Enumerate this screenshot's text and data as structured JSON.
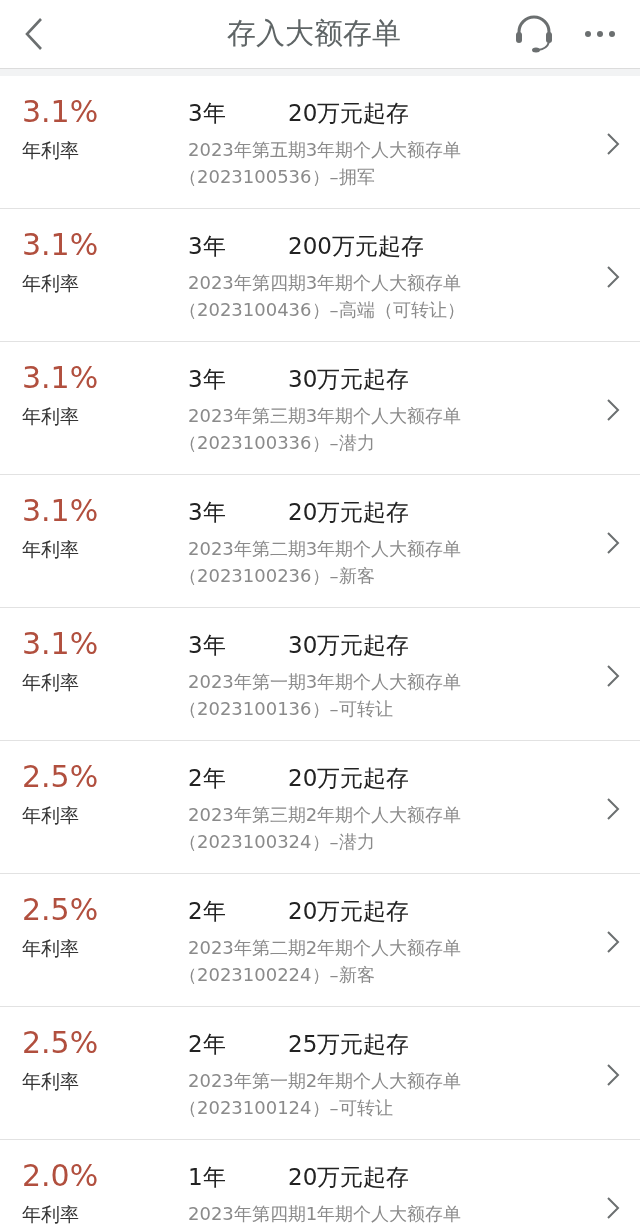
{
  "header": {
    "title": "存入大额存单"
  },
  "products": [
    {
      "rate": "3.1%",
      "rate_label": "年利率",
      "term": "3年",
      "minimum": "20万元起存",
      "name": "2023年第五期3年期个人大额存单",
      "code": "（2023100536）–拥军"
    },
    {
      "rate": "3.1%",
      "rate_label": "年利率",
      "term": "3年",
      "minimum": "200万元起存",
      "name": "2023年第四期3年期个人大额存单",
      "code": "（2023100436）–高端（可转让）"
    },
    {
      "rate": "3.1%",
      "rate_label": "年利率",
      "term": "3年",
      "minimum": "30万元起存",
      "name": "2023年第三期3年期个人大额存单",
      "code": "（2023100336）–潜力"
    },
    {
      "rate": "3.1%",
      "rate_label": "年利率",
      "term": "3年",
      "minimum": "20万元起存",
      "name": "2023年第二期3年期个人大额存单",
      "code": "（2023100236）–新客"
    },
    {
      "rate": "3.1%",
      "rate_label": "年利率",
      "term": "3年",
      "minimum": "30万元起存",
      "name": "2023年第一期3年期个人大额存单",
      "code": "（2023100136）–可转让"
    },
    {
      "rate": "2.5%",
      "rate_label": "年利率",
      "term": "2年",
      "minimum": "20万元起存",
      "name": "2023年第三期2年期个人大额存单",
      "code": "（2023100324）–潜力"
    },
    {
      "rate": "2.5%",
      "rate_label": "年利率",
      "term": "2年",
      "minimum": "20万元起存",
      "name": "2023年第二期2年期个人大额存单",
      "code": "（2023100224）–新客"
    },
    {
      "rate": "2.5%",
      "rate_label": "年利率",
      "term": "2年",
      "minimum": "25万元起存",
      "name": "2023年第一期2年期个人大额存单",
      "code": "（2023100124）–可转让"
    },
    {
      "rate": "2.0%",
      "rate_label": "年利率",
      "term": "1年",
      "minimum": "20万元起存",
      "name": "2023年第四期1年期个人大额存单"
    }
  ]
}
